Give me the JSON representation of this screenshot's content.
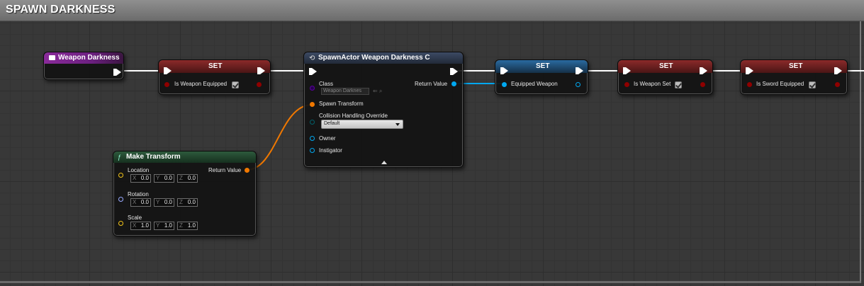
{
  "comment": {
    "title": "SPAWN DARKNESS"
  },
  "event_node": {
    "title": "Weapon Darkness",
    "icon": "event-icon"
  },
  "set_nodes": [
    {
      "title": "SET",
      "variable": "Is Weapon Equipped",
      "checked": true
    },
    {
      "title": "SET",
      "variable": "Equipped Weapon"
    },
    {
      "title": "SET",
      "variable": "Is Weapon Set",
      "checked": true
    },
    {
      "title": "SET",
      "variable": "Is Sword Equipped",
      "checked": true
    }
  ],
  "spawn_node": {
    "title": "SpawnActor Weapon Darkness C",
    "class_label": "Class",
    "class_value": "Weapon Darknes",
    "return_label": "Return Value",
    "spawn_transform_label": "Spawn Transform",
    "collision_label": "Collision Handling Override",
    "collision_value": "Default",
    "owner_label": "Owner",
    "instigator_label": "Instigator"
  },
  "make_transform": {
    "title": "Make Transform",
    "return_label": "Return Value",
    "location": {
      "label": "Location",
      "x": "0.0",
      "y": "0.0",
      "z": "0.0"
    },
    "rotation": {
      "label": "Rotation",
      "x": "0.0",
      "y": "0.0",
      "z": "0.0"
    },
    "scale": {
      "label": "Scale",
      "x": "1.0",
      "y": "1.0",
      "z": "1.0"
    }
  },
  "axes": {
    "x": "X",
    "y": "Y",
    "z": "Z"
  },
  "colors": {
    "event_header": "#8a2a9a",
    "set_header": "#8b2a2a",
    "set_object_header": "#2a6aa0",
    "spawn_header": "#2e3b52",
    "make_header": "#2d5a3c",
    "bool_pin": "#8f0000",
    "object_pin": "#00a8f0",
    "struct_pin": "#f07800",
    "vector_pin": "#f2c41a",
    "rotator_pin": "#99aaff",
    "class_pin": "#5a00a0",
    "enum_pin": "#00606a"
  }
}
